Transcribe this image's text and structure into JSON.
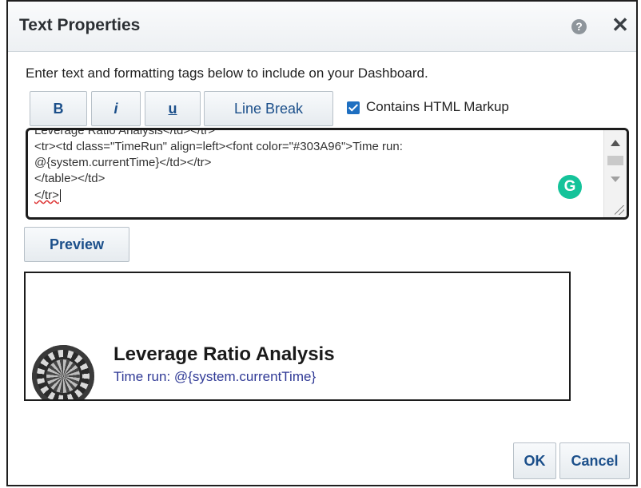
{
  "dialog": {
    "title": "Text Properties",
    "help_icon": "help-icon",
    "close_icon": "close-icon",
    "close_glyph": "✕",
    "help_glyph": "?"
  },
  "instruction": "Enter text and formatting tags below to include on your Dashboard.",
  "toolbar": {
    "bold_label": "B",
    "italic_label": "i",
    "underline_label": "u",
    "line_break_label": "Line Break",
    "contains_html_label": "Contains HTML Markup",
    "contains_html_checked": true
  },
  "editor": {
    "lines": [
      "Leverage Ratio Analysis</td></tr>",
      "<tr><td class=\"TimeRun\" align=left><font color=\"#303A96\">Time run:",
      "@{system.currentTime}</td></tr>",
      "</table></td>",
      "</tr>"
    ],
    "grammarly_glyph": "G"
  },
  "preview_button_label": "Preview",
  "preview": {
    "title": "Leverage Ratio Analysis",
    "time_run": "Time run: @{system.currentTime}",
    "time_color": "#303A96"
  },
  "footer": {
    "ok_label": "OK",
    "cancel_label": "Cancel"
  }
}
